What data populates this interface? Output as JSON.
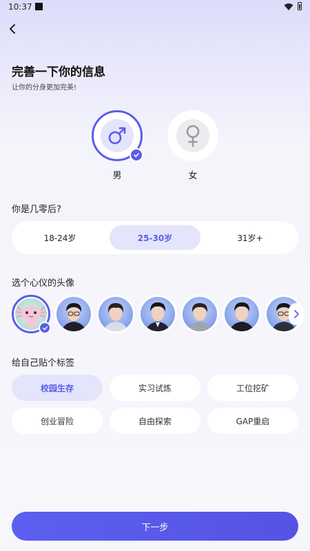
{
  "status_bar": {
    "time": "10:37"
  },
  "header": {
    "title": "完善一下你的信息",
    "subtitle": "让你的分身更加完美!"
  },
  "gender": {
    "options": [
      {
        "label": "男",
        "icon": "male-symbol-icon",
        "selected": true
      },
      {
        "label": "女",
        "icon": "female-symbol-icon",
        "selected": false
      }
    ]
  },
  "age": {
    "question": "你是几零后?",
    "options": [
      {
        "label": "18-24岁",
        "selected": false
      },
      {
        "label": "25-30岁",
        "selected": true
      },
      {
        "label": "31岁+",
        "selected": false
      }
    ]
  },
  "avatar": {
    "question": "选个心仪的头像",
    "count_visible": 7,
    "selected_index": 0
  },
  "tags": {
    "question": "给自己贴个标签",
    "items": [
      {
        "label": "校园生存",
        "selected": true
      },
      {
        "label": "实习试炼",
        "selected": false
      },
      {
        "label": "工位挖矿",
        "selected": false
      },
      {
        "label": "创业冒险",
        "selected": false
      },
      {
        "label": "自由探索",
        "selected": false
      },
      {
        "label": "GAP重启",
        "selected": false
      }
    ]
  },
  "footer": {
    "next_label": "下一步"
  },
  "colors": {
    "accent": "#5a5de8",
    "accent_light": "#e4e4fb",
    "background": "#f6f6fb"
  }
}
